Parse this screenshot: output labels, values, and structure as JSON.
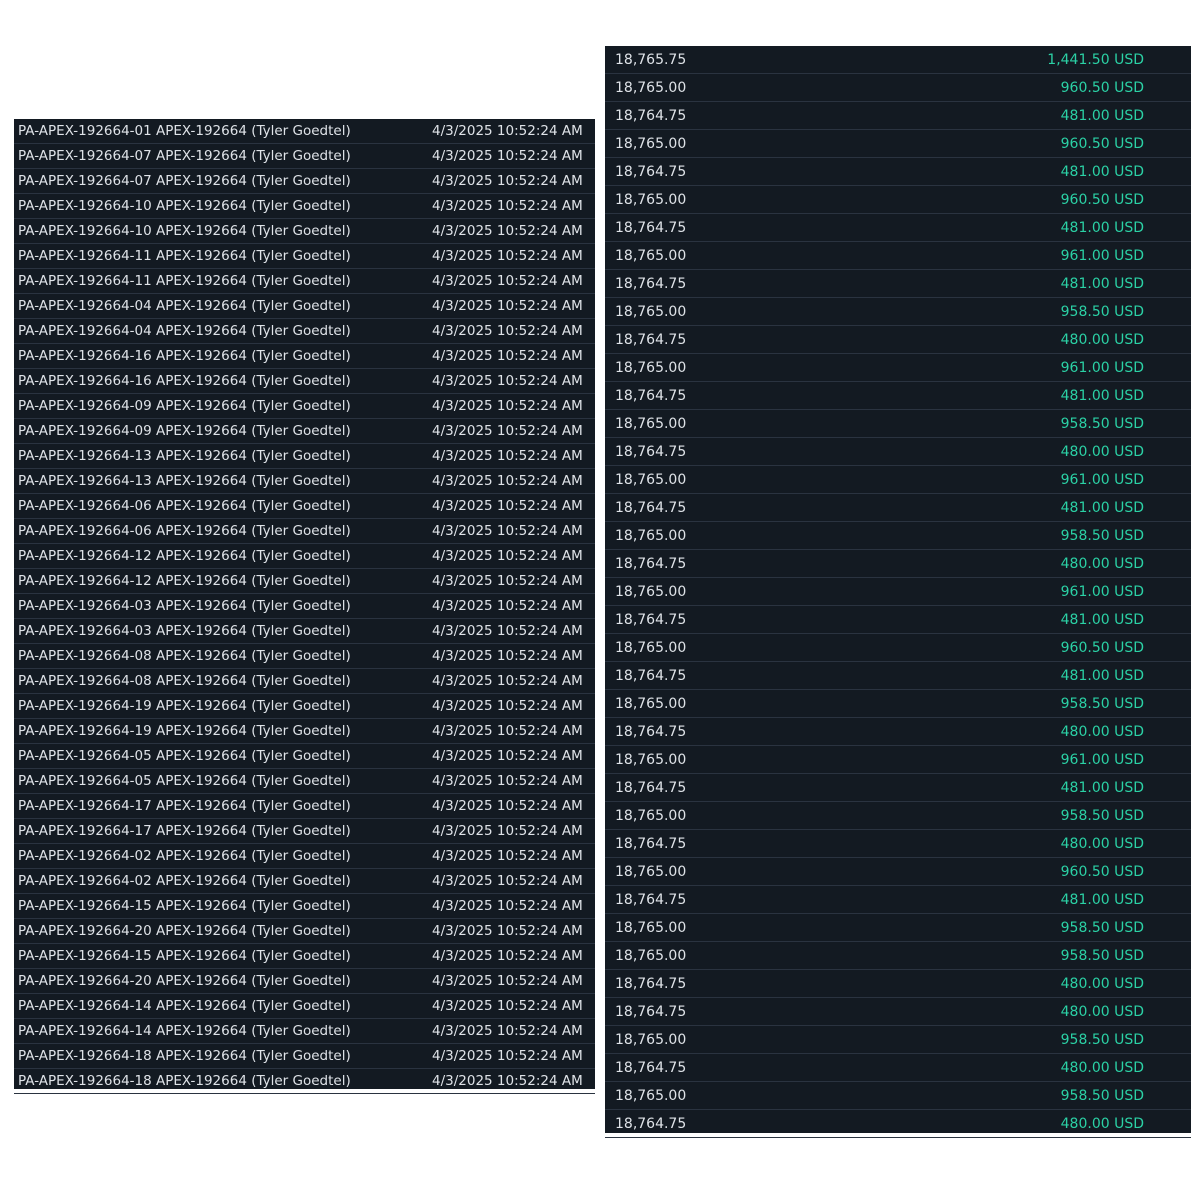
{
  "colors": {
    "background": "#131a22",
    "text": "#dfe3e8",
    "profit": "#2bd1a5",
    "divider": "#2a3340"
  },
  "left_table": {
    "rows": [
      {
        "account": "PA-APEX-192664-01 APEX-192664 (Tyler Goedtel)",
        "time": "4/3/2025 10:52:24 AM"
      },
      {
        "account": "PA-APEX-192664-07 APEX-192664 (Tyler Goedtel)",
        "time": "4/3/2025 10:52:24 AM"
      },
      {
        "account": "PA-APEX-192664-07 APEX-192664 (Tyler Goedtel)",
        "time": "4/3/2025 10:52:24 AM"
      },
      {
        "account": "PA-APEX-192664-10 APEX-192664 (Tyler Goedtel)",
        "time": "4/3/2025 10:52:24 AM"
      },
      {
        "account": "PA-APEX-192664-10 APEX-192664 (Tyler Goedtel)",
        "time": "4/3/2025 10:52:24 AM"
      },
      {
        "account": "PA-APEX-192664-11 APEX-192664 (Tyler Goedtel)",
        "time": "4/3/2025 10:52:24 AM"
      },
      {
        "account": "PA-APEX-192664-11 APEX-192664 (Tyler Goedtel)",
        "time": "4/3/2025 10:52:24 AM"
      },
      {
        "account": "PA-APEX-192664-04 APEX-192664 (Tyler Goedtel)",
        "time": "4/3/2025 10:52:24 AM"
      },
      {
        "account": "PA-APEX-192664-04 APEX-192664 (Tyler Goedtel)",
        "time": "4/3/2025 10:52:24 AM"
      },
      {
        "account": "PA-APEX-192664-16 APEX-192664 (Tyler Goedtel)",
        "time": "4/3/2025 10:52:24 AM"
      },
      {
        "account": "PA-APEX-192664-16 APEX-192664 (Tyler Goedtel)",
        "time": "4/3/2025 10:52:24 AM"
      },
      {
        "account": "PA-APEX-192664-09 APEX-192664 (Tyler Goedtel)",
        "time": "4/3/2025 10:52:24 AM"
      },
      {
        "account": "PA-APEX-192664-09 APEX-192664 (Tyler Goedtel)",
        "time": "4/3/2025 10:52:24 AM"
      },
      {
        "account": "PA-APEX-192664-13 APEX-192664 (Tyler Goedtel)",
        "time": "4/3/2025 10:52:24 AM"
      },
      {
        "account": "PA-APEX-192664-13 APEX-192664 (Tyler Goedtel)",
        "time": "4/3/2025 10:52:24 AM"
      },
      {
        "account": "PA-APEX-192664-06 APEX-192664 (Tyler Goedtel)",
        "time": "4/3/2025 10:52:24 AM"
      },
      {
        "account": "PA-APEX-192664-06 APEX-192664 (Tyler Goedtel)",
        "time": "4/3/2025 10:52:24 AM"
      },
      {
        "account": "PA-APEX-192664-12 APEX-192664 (Tyler Goedtel)",
        "time": "4/3/2025 10:52:24 AM"
      },
      {
        "account": "PA-APEX-192664-12 APEX-192664 (Tyler Goedtel)",
        "time": "4/3/2025 10:52:24 AM"
      },
      {
        "account": "PA-APEX-192664-03 APEX-192664 (Tyler Goedtel)",
        "time": "4/3/2025 10:52:24 AM"
      },
      {
        "account": "PA-APEX-192664-03 APEX-192664 (Tyler Goedtel)",
        "time": "4/3/2025 10:52:24 AM"
      },
      {
        "account": "PA-APEX-192664-08 APEX-192664 (Tyler Goedtel)",
        "time": "4/3/2025 10:52:24 AM"
      },
      {
        "account": "PA-APEX-192664-08 APEX-192664 (Tyler Goedtel)",
        "time": "4/3/2025 10:52:24 AM"
      },
      {
        "account": "PA-APEX-192664-19 APEX-192664 (Tyler Goedtel)",
        "time": "4/3/2025 10:52:24 AM"
      },
      {
        "account": "PA-APEX-192664-19 APEX-192664 (Tyler Goedtel)",
        "time": "4/3/2025 10:52:24 AM"
      },
      {
        "account": "PA-APEX-192664-05 APEX-192664 (Tyler Goedtel)",
        "time": "4/3/2025 10:52:24 AM"
      },
      {
        "account": "PA-APEX-192664-05 APEX-192664 (Tyler Goedtel)",
        "time": "4/3/2025 10:52:24 AM"
      },
      {
        "account": "PA-APEX-192664-17 APEX-192664 (Tyler Goedtel)",
        "time": "4/3/2025 10:52:24 AM"
      },
      {
        "account": "PA-APEX-192664-17 APEX-192664 (Tyler Goedtel)",
        "time": "4/3/2025 10:52:24 AM"
      },
      {
        "account": "PA-APEX-192664-02 APEX-192664 (Tyler Goedtel)",
        "time": "4/3/2025 10:52:24 AM"
      },
      {
        "account": "PA-APEX-192664-02 APEX-192664 (Tyler Goedtel)",
        "time": "4/3/2025 10:52:24 AM"
      },
      {
        "account": "PA-APEX-192664-15 APEX-192664 (Tyler Goedtel)",
        "time": "4/3/2025 10:52:24 AM"
      },
      {
        "account": "PA-APEX-192664-20 APEX-192664 (Tyler Goedtel)",
        "time": "4/3/2025 10:52:24 AM"
      },
      {
        "account": "PA-APEX-192664-15 APEX-192664 (Tyler Goedtel)",
        "time": "4/3/2025 10:52:24 AM"
      },
      {
        "account": "PA-APEX-192664-20 APEX-192664 (Tyler Goedtel)",
        "time": "4/3/2025 10:52:24 AM"
      },
      {
        "account": "PA-APEX-192664-14 APEX-192664 (Tyler Goedtel)",
        "time": "4/3/2025 10:52:24 AM"
      },
      {
        "account": "PA-APEX-192664-14 APEX-192664 (Tyler Goedtel)",
        "time": "4/3/2025 10:52:24 AM"
      },
      {
        "account": "PA-APEX-192664-18 APEX-192664 (Tyler Goedtel)",
        "time": "4/3/2025 10:52:24 AM"
      },
      {
        "account": "PA-APEX-192664-18 APEX-192664 (Tyler Goedtel)",
        "time": "4/3/2025 10:52:24 AM"
      }
    ]
  },
  "right_table": {
    "rows": [
      {
        "price": "18,765.75",
        "pnl": "1,441.50 USD"
      },
      {
        "price": "18,765.00",
        "pnl": "960.50 USD"
      },
      {
        "price": "18,764.75",
        "pnl": "481.00 USD"
      },
      {
        "price": "18,765.00",
        "pnl": "960.50 USD"
      },
      {
        "price": "18,764.75",
        "pnl": "481.00 USD"
      },
      {
        "price": "18,765.00",
        "pnl": "960.50 USD"
      },
      {
        "price": "18,764.75",
        "pnl": "481.00 USD"
      },
      {
        "price": "18,765.00",
        "pnl": "961.00 USD"
      },
      {
        "price": "18,764.75",
        "pnl": "481.00 USD"
      },
      {
        "price": "18,765.00",
        "pnl": "958.50 USD"
      },
      {
        "price": "18,764.75",
        "pnl": "480.00 USD"
      },
      {
        "price": "18,765.00",
        "pnl": "961.00 USD"
      },
      {
        "price": "18,764.75",
        "pnl": "481.00 USD"
      },
      {
        "price": "18,765.00",
        "pnl": "958.50 USD"
      },
      {
        "price": "18,764.75",
        "pnl": "480.00 USD"
      },
      {
        "price": "18,765.00",
        "pnl": "961.00 USD"
      },
      {
        "price": "18,764.75",
        "pnl": "481.00 USD"
      },
      {
        "price": "18,765.00",
        "pnl": "958.50 USD"
      },
      {
        "price": "18,764.75",
        "pnl": "480.00 USD"
      },
      {
        "price": "18,765.00",
        "pnl": "961.00 USD"
      },
      {
        "price": "18,764.75",
        "pnl": "481.00 USD"
      },
      {
        "price": "18,765.00",
        "pnl": "960.50 USD"
      },
      {
        "price": "18,764.75",
        "pnl": "481.00 USD"
      },
      {
        "price": "18,765.00",
        "pnl": "958.50 USD"
      },
      {
        "price": "18,764.75",
        "pnl": "480.00 USD"
      },
      {
        "price": "18,765.00",
        "pnl": "961.00 USD"
      },
      {
        "price": "18,764.75",
        "pnl": "481.00 USD"
      },
      {
        "price": "18,765.00",
        "pnl": "958.50 USD"
      },
      {
        "price": "18,764.75",
        "pnl": "480.00 USD"
      },
      {
        "price": "18,765.00",
        "pnl": "960.50 USD"
      },
      {
        "price": "18,764.75",
        "pnl": "481.00 USD"
      },
      {
        "price": "18,765.00",
        "pnl": "958.50 USD"
      },
      {
        "price": "18,765.00",
        "pnl": "958.50 USD"
      },
      {
        "price": "18,764.75",
        "pnl": "480.00 USD"
      },
      {
        "price": "18,764.75",
        "pnl": "480.00 USD"
      },
      {
        "price": "18,765.00",
        "pnl": "958.50 USD"
      },
      {
        "price": "18,764.75",
        "pnl": "480.00 USD"
      },
      {
        "price": "18,765.00",
        "pnl": "958.50 USD"
      },
      {
        "price": "18,764.75",
        "pnl": "480.00 USD"
      }
    ]
  }
}
